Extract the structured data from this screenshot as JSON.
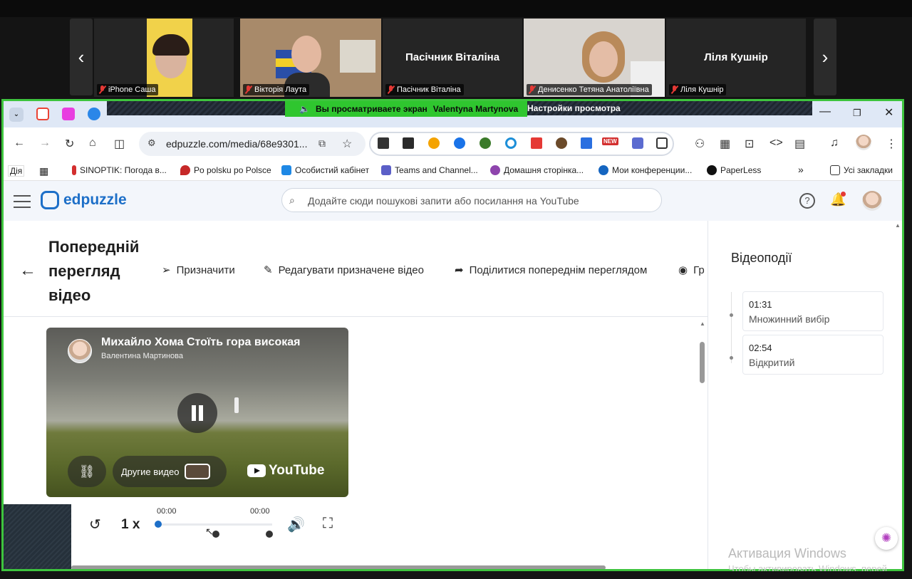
{
  "conference": {
    "participants": [
      {
        "label": "iPhone Саша"
      },
      {
        "label": "Вікторія Лаута"
      },
      {
        "label": "Пасічник Віталіна",
        "display_name": "Пасічник Віталіна"
      },
      {
        "label": "Денисенко Тетяна Анатоліївна"
      },
      {
        "label": "Ліля Кушнір",
        "display_name": "Ліля Кушнір"
      }
    ],
    "prev_icon": "‹",
    "next_icon": "›",
    "share_text": "Вы просматриваете экран",
    "sharer": "Valentyna Martynova",
    "view_settings": "Настройки просмотра"
  },
  "browser": {
    "url": "edpuzzle.com/media/68e9301...",
    "new_badge": "NEW",
    "bookmarks": [
      "Дія",
      "SINOPTIK: Погода в...",
      "Po polsku po Polsce",
      "Особистий кабінет",
      "Teams and Channel...",
      "Домашня сторінка...",
      "Мои конференции...",
      "PaperLess",
      "Усі закладки"
    ],
    "more_bookmarks": "»"
  },
  "edpuzzle": {
    "logo": "edpuzzle",
    "search_placeholder": "Додайте сюди пошукові запити або посилання на YouTube",
    "page_title": "Попередній перегляд відео",
    "actions": [
      "Призначити",
      "Редагувати призначене відео",
      "Поділитися попереднім переглядом",
      "Гр"
    ],
    "video": {
      "title": "Михайло Хома Стоїть гора високая",
      "author": "Валентина Мартинова",
      "more_videos": "Другие видео",
      "youtube": "YouTube"
    },
    "player": {
      "speed": "1 x",
      "time_current": "00:00",
      "time_total": "00:00"
    },
    "side_title": "Відеоподії",
    "events": [
      {
        "time": "01:31",
        "kind": "Множинний вибір"
      },
      {
        "time": "02:54",
        "kind": "Відкритий"
      }
    ]
  },
  "windows": {
    "activation_title": "Активация Windows",
    "activation_sub": "Чтобы активировать Windows, перей"
  },
  "colors": {
    "share_border": "#3ec43e",
    "edpuzzle_blue": "#1d6fc8"
  }
}
